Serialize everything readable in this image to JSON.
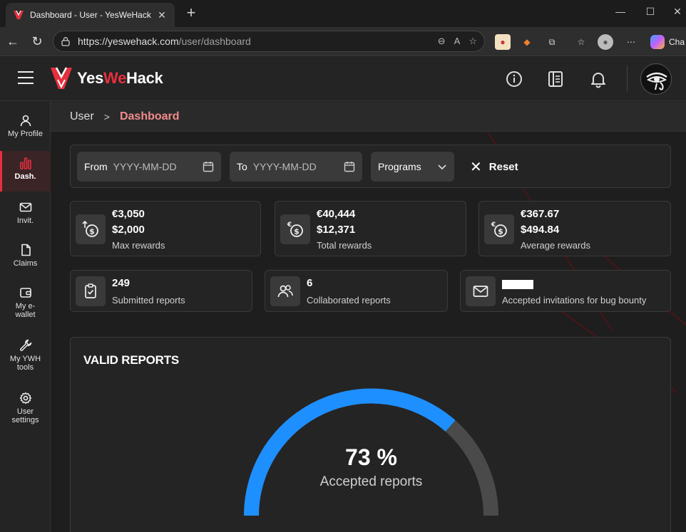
{
  "browser": {
    "tab_title": "Dashboard - User - YesWeHack",
    "url_host": "https://yeswehack.com",
    "url_path": "/user/dashboard",
    "copilot_label": "Cha"
  },
  "app": {
    "logo_yes": "Yes",
    "logo_we": "We",
    "logo_hack": "Hack"
  },
  "sidebar": {
    "items": [
      {
        "label": "My Profile"
      },
      {
        "label": "Dash."
      },
      {
        "label": "Invit."
      },
      {
        "label": "Claims"
      },
      {
        "label_1": "My e-",
        "label_2": "wallet"
      },
      {
        "label_1": "My YWH",
        "label_2": "tools"
      },
      {
        "label_1": "User",
        "label_2": "settings"
      }
    ]
  },
  "breadcrumb": {
    "root": "User",
    "current": "Dashboard"
  },
  "filters": {
    "from_label": "From",
    "from_placeholder": "YYYY-MM-DD",
    "to_label": "To",
    "to_placeholder": "YYYY-MM-DD",
    "programs_label": "Programs",
    "reset_label": "Reset"
  },
  "stats": {
    "max_rewards": {
      "value_1": "€3,050",
      "value_2": "$2,000",
      "label": "Max rewards"
    },
    "total_rewards": {
      "value_1": "€40,444",
      "value_2": "$12,371",
      "label": "Total rewards"
    },
    "average_rewards": {
      "value_1": "€367.67",
      "value_2": "$494.84",
      "label": "Average rewards"
    },
    "submitted": {
      "value": "249",
      "label": "Submitted reports"
    },
    "collaborated": {
      "value": "6",
      "label": "Collaborated reports"
    },
    "invitations": {
      "label": "Accepted invitations for bug bounty"
    }
  },
  "valid_reports": {
    "title": "VALID REPORTS",
    "percent_text": "73 %",
    "percent_value": 73,
    "label": "Accepted reports"
  },
  "colors": {
    "accent": "#e5303e",
    "gauge_fill": "#1e8fff",
    "gauge_track": "#4a4a4a"
  }
}
